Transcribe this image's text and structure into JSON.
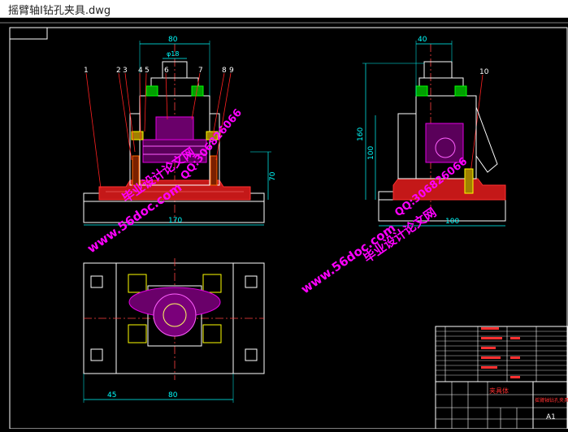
{
  "window": {
    "title": "摇臂轴I钻孔夹具.dwg"
  },
  "dimensions": {
    "front_width": "80",
    "front_bore": "φ18",
    "front_height": "70",
    "front_base": "170",
    "side_width": "40",
    "side_height_total": "160",
    "side_height_inner": "100",
    "side_base": "100",
    "plan_left": "45",
    "plan_right": "80"
  },
  "balloons": [
    "1",
    "2",
    "3",
    "4",
    "5",
    "6",
    "7",
    "8",
    "9",
    "10"
  ],
  "watermarks": {
    "site": "www.56doc.com",
    "brand": "毕业设计论文网",
    "qq": "QQ:306826066"
  },
  "title_block": {
    "part_label": "夹具体",
    "drawing_name": "摇臂轴钻孔夹具",
    "sheet_size": "A1"
  },
  "colors": {
    "background": "#000000",
    "outline": "#ffffff",
    "dimension": "#00ffff",
    "leader": "#ff2020",
    "hatch": "#ff3030",
    "part": "#e000e0",
    "fixture": "#ffff00",
    "centerline": "#ff4040",
    "watermark": "#ff00ff"
  }
}
